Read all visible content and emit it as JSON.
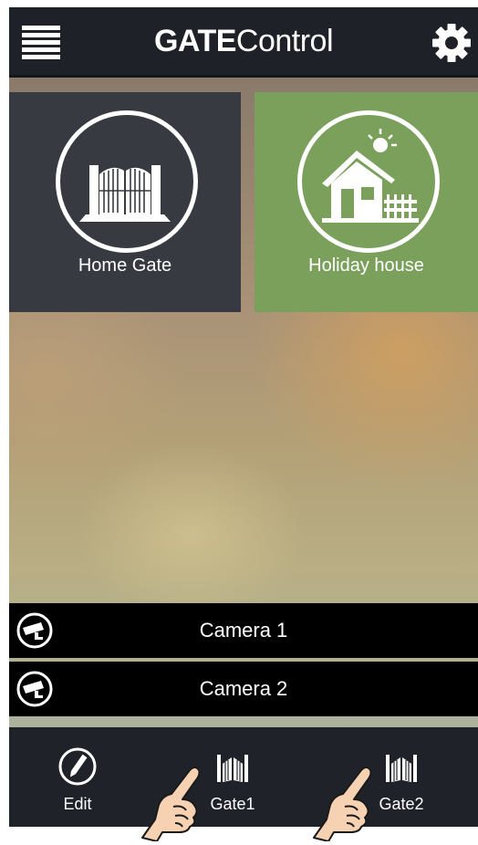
{
  "header": {
    "title_bold": "GATE",
    "title_light": "Control",
    "menu_icon": "hamburger-menu-icon",
    "settings_icon": "gear-icon"
  },
  "tiles": [
    {
      "label": "Home Gate",
      "icon": "gate-icon",
      "color": "#373a40"
    },
    {
      "label": "Holiday house",
      "icon": "house-icon",
      "color": "#7aa05c"
    }
  ],
  "cameras": [
    {
      "label": "Camera 1",
      "icon": "security-camera-icon"
    },
    {
      "label": "Camera 2",
      "icon": "security-camera-icon"
    }
  ],
  "bottom_bar": {
    "edit_label": "Edit",
    "gate1_label": "Gate1",
    "gate2_label": "Gate2"
  }
}
